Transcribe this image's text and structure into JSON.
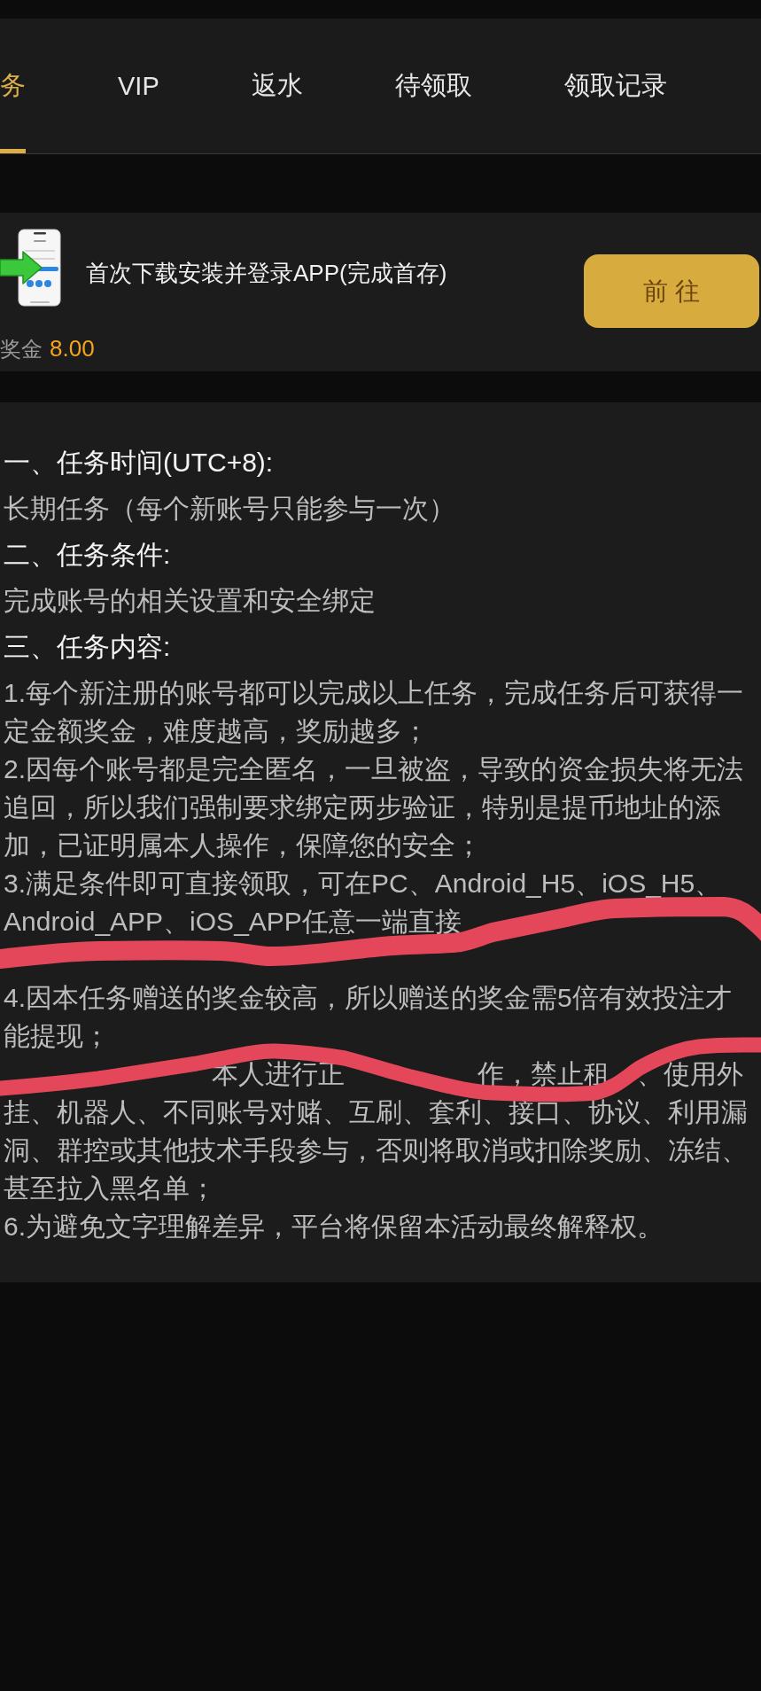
{
  "tabs": [
    {
      "label": "务",
      "selected": true
    },
    {
      "label": "VIP",
      "selected": false
    },
    {
      "label": "返水",
      "selected": false
    },
    {
      "label": "待领取",
      "selected": false
    },
    {
      "label": "领取记录",
      "selected": false
    }
  ],
  "task": {
    "title": "首次下载安装并登录APP(完成首存)",
    "button": "前 往",
    "reward_label": "奖金",
    "reward_value": "8.00"
  },
  "rules": [
    {
      "kind": "heading",
      "text": "一、任务时间(UTC+8):"
    },
    {
      "kind": "body",
      "text": "长期任务（每个新账号只能参与一次）"
    },
    {
      "kind": "heading",
      "text": "二、任务条件:"
    },
    {
      "kind": "body",
      "text": "完成账号的相关设置和安全绑定"
    },
    {
      "kind": "heading",
      "text": "三、任务内容:"
    },
    {
      "kind": "item",
      "text": "1.每个新注册的账号都可以完成以上任务，完成任务后可获得一定金额奖金，难度越高，奖励越多；"
    },
    {
      "kind": "item",
      "text": "2.因每个账号都是完全匿名，一旦被盗，导致的资金损失将无法追回，所以我们强制要求绑定两步验证，特别是提币地址的添加，已证明属本人操作，保障您的安全；"
    },
    {
      "kind": "covered_item",
      "lines": [
        [
          "3.满足条件即可直接领取，可在PC、Android_H5、iOS_H5、"
        ],
        [
          "Android_APP、iOS_APP任意一端直接"
        ]
      ]
    },
    {
      "kind": "item",
      "text": "4.因本任务赠送的奖金较高，所以赠送的奖金需5倍有效投注才能提现；"
    },
    {
      "kind": "covered_item",
      "lines": [
        [
          "本人进行正",
          "作，禁止租",
          "、使用外"
        ]
      ],
      "text": "挂、机器人、不同账号对赌、互刷、套利、接口、协议、利用漏洞、群控或其他技术手段参与，否则将取消或扣除奖励、冻结、甚至拉入黑名单；"
    },
    {
      "kind": "item",
      "text": "6.为避免文字理解差异，平台将保留本活动最终解释权。"
    }
  ]
}
